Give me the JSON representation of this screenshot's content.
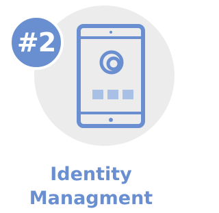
{
  "badge": {
    "text": "#2"
  },
  "title": {
    "line1": "Identity",
    "line2": "Managment"
  },
  "colors": {
    "accent": "#6a8fd1",
    "accent_light": "#a9c0e6",
    "circle_bg": "#ececec"
  },
  "icons": {
    "device": "tablet-icon",
    "app": "fingerprint-logo-icon",
    "tiles": "app-tile-icon"
  }
}
